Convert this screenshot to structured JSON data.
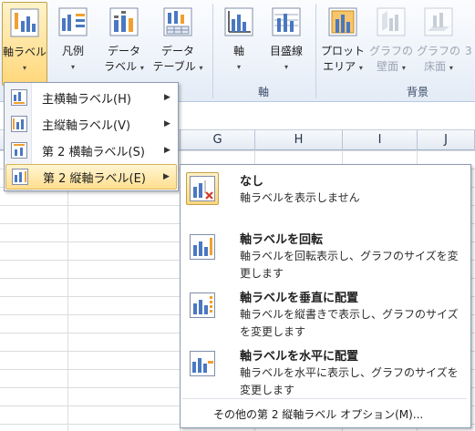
{
  "ribbon": {
    "buttons": [
      {
        "label1": "軸ラベル",
        "label2": ""
      },
      {
        "label1": "凡例",
        "label2": ""
      },
      {
        "label1": "データ",
        "label2": "ラベル"
      },
      {
        "label1": "データ",
        "label2": "テーブル"
      },
      {
        "label1": "軸",
        "label2": ""
      },
      {
        "label1": "目盛線",
        "label2": ""
      },
      {
        "label1": "プロット",
        "label2": "エリア"
      },
      {
        "label1": "グラフの",
        "label2": "壁面"
      },
      {
        "label1": "グラフの",
        "label2": "床面"
      },
      {
        "label1": "3",
        "label2": ""
      }
    ],
    "group_axes_label": "軸",
    "group_background_label": "背景",
    "caret": "▾"
  },
  "sheet": {
    "columns": [
      "G",
      "H",
      "I",
      "J"
    ]
  },
  "menu_level1": {
    "items": [
      {
        "label": "主横軸ラベル(H)",
        "arrow": "▶"
      },
      {
        "label": "主縦軸ラベル(V)",
        "arrow": "▶"
      },
      {
        "label": "第 2 横軸ラベル(S)",
        "arrow": "▶"
      },
      {
        "label": "第 2 縦軸ラベル(E)",
        "arrow": "▶"
      }
    ]
  },
  "submenu": {
    "items": [
      {
        "title": "なし",
        "desc": "軸ラベルを表示しません"
      },
      {
        "title": "軸ラベルを回転",
        "desc": "軸ラベルを回転表示し、グラフのサイズを変更します"
      },
      {
        "title": "軸ラベルを垂直に配置",
        "desc": "軸ラベルを縦書きで表示し、グラフのサイズを変更します"
      },
      {
        "title": "軸ラベルを水平に配置",
        "desc": "軸ラベルを水平に表示し、グラフのサイズを変更します"
      }
    ],
    "more_options": "その他の第 2 縦軸ラベル オプション(M)..."
  },
  "colors": {
    "accent_highlight": "#ffd77a",
    "chart_icon_blue": "#4a78c2",
    "chart_icon_orange": "#f0a030",
    "delete_red": "#d23b2b"
  }
}
